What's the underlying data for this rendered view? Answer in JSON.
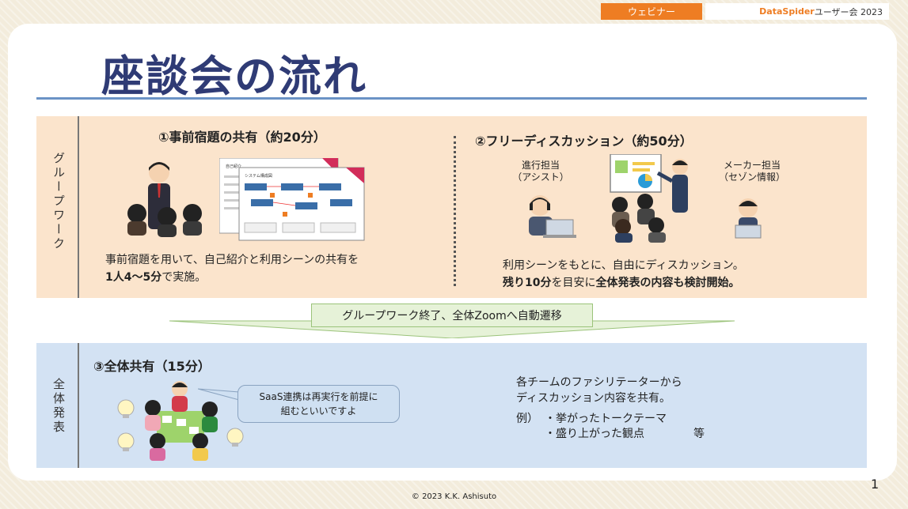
{
  "header": {
    "tag": "ウェビナー",
    "brand": "DataSpider",
    "brand_suffix": "ユーザー会 2023"
  },
  "title": "座談会の流れ",
  "group_work": {
    "side_label": "グループワーク",
    "section1": {
      "heading": "①事前宿題の共有（約20分）",
      "doc_title": "自己紹介",
      "doc_subtitle": "システム構成図",
      "line1": "事前宿題を用いて、自己紹介と利用シーンの共有を",
      "line2_bold": "1人4〜5分",
      "line2_rest": "で実施。"
    },
    "section2": {
      "heading": "②フリーディスカッション（約50分）",
      "label_left_1": "進行担当",
      "label_left_2": "（アシスト）",
      "label_right_1": "メーカー担当",
      "label_right_2": "（セゾン情報）",
      "line1": "利用シーンをもとに、自由にディスカッション。",
      "line2_bold1": "残り10分",
      "line2_mid": "を目安に",
      "line2_bold2": "全体発表の内容も検討開始。"
    }
  },
  "transition": {
    "label": "グループワーク終了、全体Zoomへ自動遷移"
  },
  "presentation": {
    "side_label": "全体発表",
    "heading": "③全体共有（15分）",
    "bubble_line1": "SaaS連携は再実行を前提に",
    "bubble_line2": "組むといいですよ",
    "desc_line1": "各チームのファシリテーターから",
    "desc_line2": "ディスカッション内容を共有。",
    "example_prefix": "例）",
    "example1": "・挙がったトークテーマ",
    "example2": "・盛り上がった観点",
    "example_suffix": "等"
  },
  "footer": "© 2023 K.K. Ashisuto",
  "page_number": "1",
  "colors": {
    "accent_orange": "#ee7d23",
    "title_navy": "#2f3b75",
    "panel_peach": "#fbe4cc",
    "panel_blue": "#d3e2f3",
    "arrow_green": "#e6f2d8"
  }
}
